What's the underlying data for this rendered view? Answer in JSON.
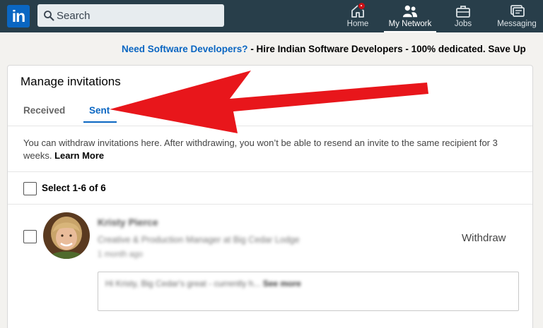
{
  "nav": {
    "logo_text": "in",
    "search_placeholder": "Search",
    "items": [
      {
        "label": "Home",
        "icon": "home-icon"
      },
      {
        "label": "My Network",
        "icon": "my-network-icon"
      },
      {
        "label": "Jobs",
        "icon": "jobs-icon"
      },
      {
        "label": "Messaging",
        "icon": "messaging-icon"
      }
    ]
  },
  "ad": {
    "link_text": "Need Software Developers?",
    "text": " - Hire Indian Software Developers - 100% dedicated. Save Up"
  },
  "invitations": {
    "title": "Manage invitations",
    "tabs": {
      "received": "Received",
      "sent": "Sent"
    },
    "notice": "You can withdraw invitations here. After withdrawing, you won’t be able to resend an invite to the same recipient for 3 weeks.",
    "learn_more": "Learn More",
    "select_label": "Select 1-6 of 6",
    "item": {
      "name": "Kristy Pierce",
      "headline": "Creative & Production Manager at Big Cedar Lodge",
      "time": "1 month ago",
      "action": "Withdraw",
      "message": "Hi Kristy, Big Cedar's great - currently h...",
      "see_more": "See more"
    }
  },
  "colors": {
    "nav_bg": "#283e4a",
    "brand_blue": "#0a66c2",
    "annotation_arrow": "#e8161b"
  }
}
